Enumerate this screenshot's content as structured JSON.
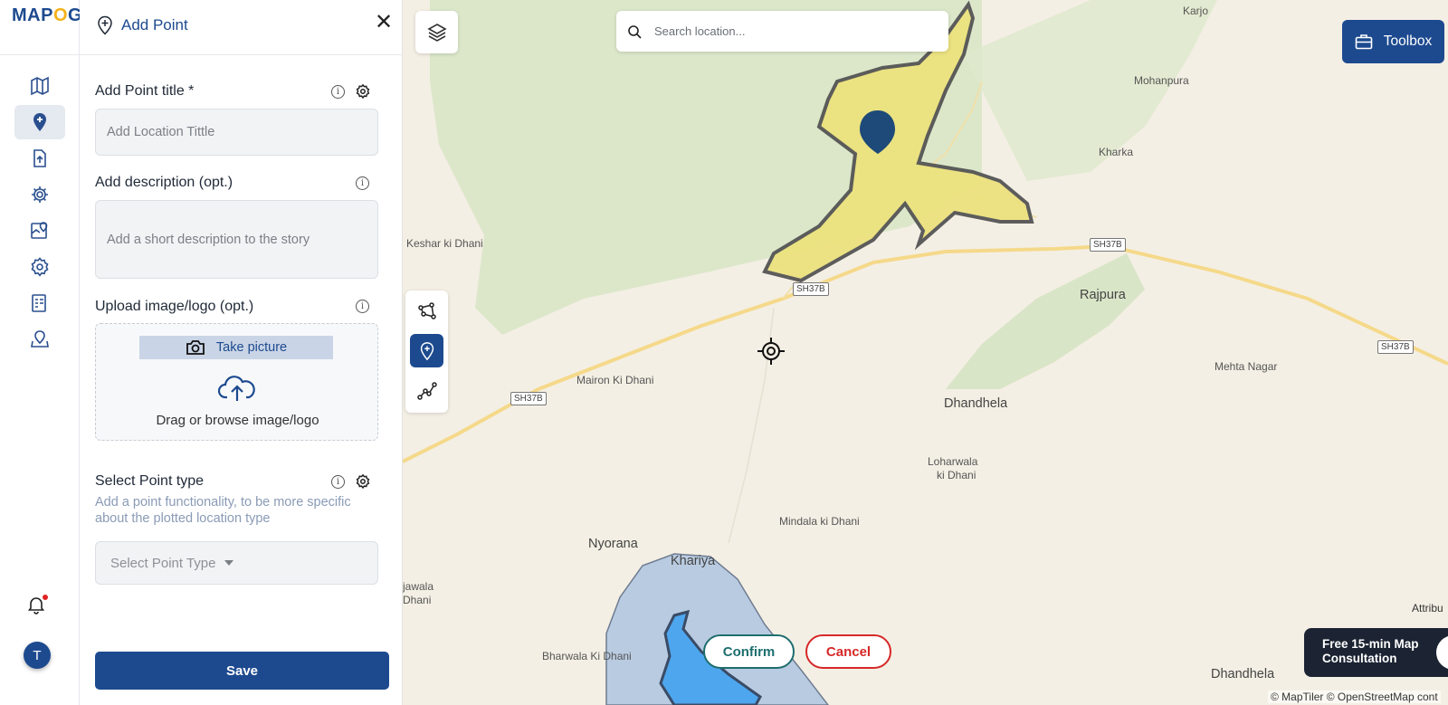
{
  "app": {
    "logo_text": "MAPOG"
  },
  "rail": {
    "items": [
      {
        "name": "map-icon"
      },
      {
        "name": "add-point-icon",
        "active": true
      },
      {
        "name": "upload-icon"
      },
      {
        "name": "settings-icon"
      },
      {
        "name": "map-pin-icon"
      },
      {
        "name": "gear-icon"
      },
      {
        "name": "report-icon"
      },
      {
        "name": "location-share-icon"
      }
    ],
    "avatar_letter": "T"
  },
  "panel": {
    "title": "Add Point",
    "point_title_label": "Add Point title *",
    "point_title_placeholder": "Add Location Tittle",
    "description_label": "Add description (opt.)",
    "description_placeholder": "Add a short description to the story",
    "upload_label": "Upload image/logo (opt.)",
    "take_picture_label": "Take picture",
    "upload_hint": "Drag or browse image/logo",
    "point_type_label": "Select Point type",
    "point_type_desc": "Add a point functionality, to be more specific about the plotted location type",
    "point_type_select": "Select Point Type",
    "save_label": "Save"
  },
  "map": {
    "search_placeholder": "Search location...",
    "toolbox_label": "Toolbox",
    "confirm_label": "Confirm",
    "cancel_label": "Cancel",
    "consult_line1": "Free 15-min Map",
    "consult_line2": "Consultation",
    "attribution_short": "Attribu",
    "attribution": "© MapTiler © OpenStreetMap cont",
    "labels": {
      "karjo": "Karjo",
      "mohanpura": "Mohanpura",
      "kharka": "Kharka",
      "keshar": "Keshar ki Dhani",
      "rajpura": "Rajpura",
      "mehta": "Mehta Nagar",
      "mairon": "Mairon Ki Dhani",
      "dhandhela": "Dhandhela",
      "loharwala1": "Loharwala",
      "loharwala2": "ki Dhani",
      "mindala": "Mindala ki Dhani",
      "nyorana": "Nyorana",
      "khariya": "Khariya",
      "jawala1": "jawala",
      "jawala2": "Dhani",
      "bharwala": "Bharwala Ki Dhani",
      "dhandhela2": "Dhandhela"
    },
    "shields": {
      "s1": "SH37B",
      "s2": "SH37B",
      "s3": "SH37B",
      "s4": "SH37B"
    }
  }
}
